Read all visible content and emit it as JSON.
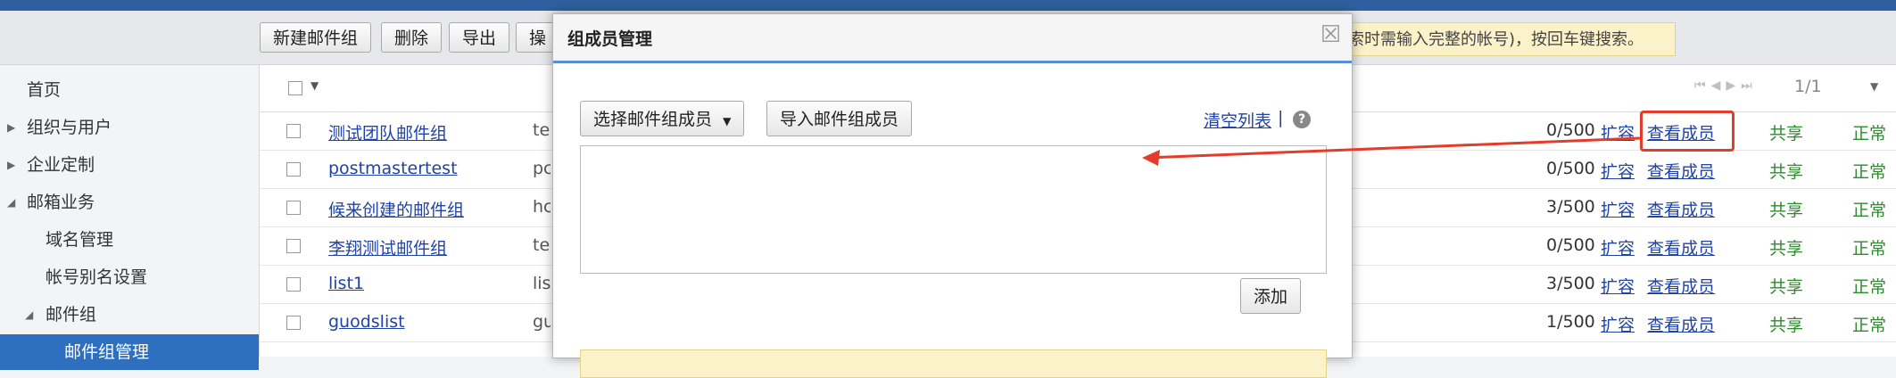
{
  "toolbar": {
    "buttons": [
      "新建邮件组",
      "删除",
      "导出",
      "操"
    ],
    "hint": "索时需输入完整的帐号)，按回车键搜索。"
  },
  "sidebar": {
    "items": [
      {
        "label": "首页",
        "level": 0,
        "arrow": ""
      },
      {
        "label": "组织与用户",
        "level": 0,
        "arrow": "▶"
      },
      {
        "label": "企业定制",
        "level": 0,
        "arrow": "▶"
      },
      {
        "label": "邮箱业务",
        "level": 0,
        "arrow": "◢"
      },
      {
        "label": "域名管理",
        "level": 1,
        "arrow": ""
      },
      {
        "label": "帐号别名设置",
        "level": 1,
        "arrow": ""
      },
      {
        "label": "邮件组",
        "level": 1,
        "arrow": "◢"
      },
      {
        "label": "邮件组管理",
        "level": 2,
        "arrow": "",
        "active": true
      }
    ]
  },
  "table": {
    "pagination": "1/1",
    "rows": [
      {
        "name": "测试团队邮件组",
        "desc": "te",
        "count": "0/500",
        "expand": "扩容",
        "view": "查看成员",
        "share": "共享",
        "status": "正常"
      },
      {
        "name": "postmastertest",
        "desc": "pc",
        "count": "0/500",
        "expand": "扩容",
        "view": "查看成员",
        "share": "共享",
        "status": "正常"
      },
      {
        "name": "候来创建的邮件组",
        "desc": "hc",
        "count": "3/500",
        "expand": "扩容",
        "view": "查看成员",
        "share": "共享",
        "status": "正常"
      },
      {
        "name": "李翔测试邮件组",
        "desc": "te",
        "count": "0/500",
        "expand": "扩容",
        "view": "查看成员",
        "share": "共享",
        "status": "正常"
      },
      {
        "name": "list1",
        "desc": "lis",
        "count": "3/500",
        "expand": "扩容",
        "view": "查看成员",
        "share": "共享",
        "status": "正常"
      },
      {
        "name": "guodslist",
        "desc": "gu",
        "count": "1/500",
        "expand": "扩容",
        "view": "查看成员",
        "share": "共享",
        "status": "正常"
      }
    ]
  },
  "dialog": {
    "title": "组成员管理",
    "close": "☒",
    "select_label": "选择邮件组成员",
    "import_label": "导入邮件组成员",
    "clear_label": "清空列表",
    "separator": "|",
    "help": "?",
    "add_label": "添加"
  },
  "colors": {
    "accent": "#2f6fc0",
    "link": "#1f43a6",
    "green": "#2e8b2e",
    "annotation": "#e23d2a"
  }
}
